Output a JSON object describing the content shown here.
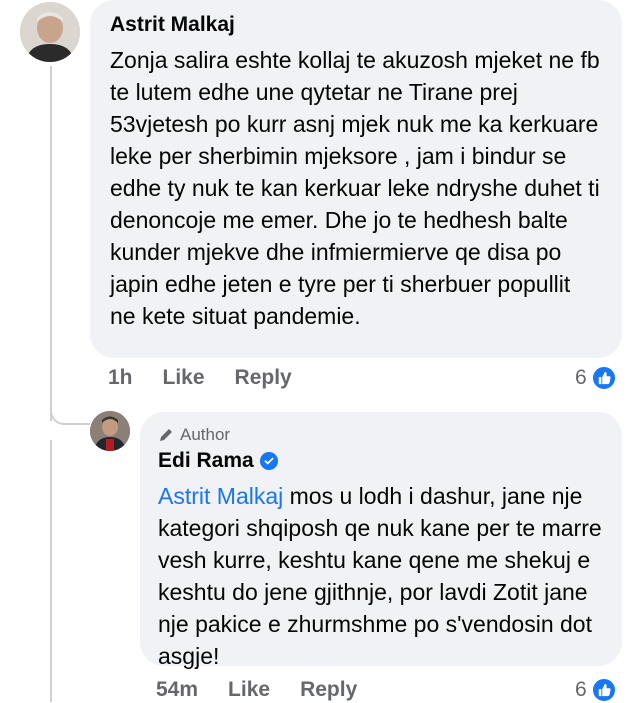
{
  "comment": {
    "author": "Astrit Malkaj",
    "text": "Zonja salira eshte kollaj te akuzosh mjeket ne fb te lutem edhe une qytetar ne Tirane prej 53vjetesh po kurr asnj mjek nuk me ka kerkuare leke per sherbimin mjeksore , jam i bindur se edhe ty nuk te kan kerkuar leke ndryshe duhet ti denoncoje me emer. Dhe jo te hedhesh balte kunder mjekve dhe infmiermierve qe disa po japin edhe jeten e tyre per ti sherbuer popullit ne kete situat pandemie.",
    "time": "1h",
    "like_label": "Like",
    "reply_label": "Reply",
    "reaction_count": "6"
  },
  "reply": {
    "badge": "Author",
    "author": "Edi Rama",
    "mention": "Astrit Malkaj",
    "text": " mos u lodh i dashur, jane nje kategori shqiposh qe nuk kane per te marre vesh kurre, keshtu kane qene me shekuj e keshtu do jene gjithnje, por lavdi Zotit jane nje pakice e zhurmshme po s'vendosin dot asgje!",
    "time": "54m",
    "like_label": "Like",
    "reply_label": "Reply",
    "reaction_count": "6"
  },
  "colors": {
    "bubble": "#f0f2f5",
    "mention": "#1876f2",
    "like_blue": "#1877f2",
    "meta_gray": "#65676b"
  }
}
